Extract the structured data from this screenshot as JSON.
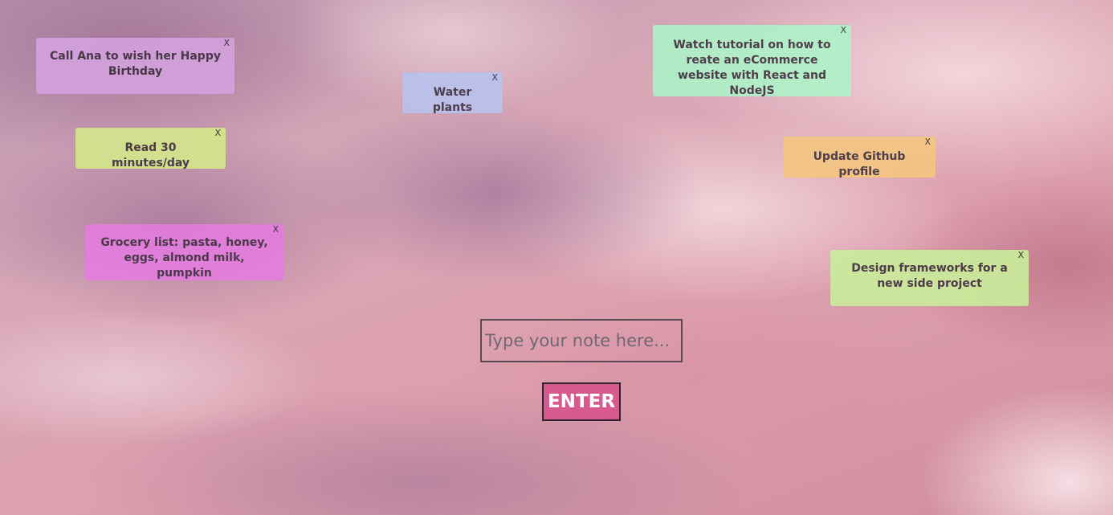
{
  "notes": [
    {
      "text": "Call Ana to wish her Happy Birthday",
      "close": "X",
      "color": "#d6a3e0"
    },
    {
      "text": "Read 30 minutes/day",
      "close": "X",
      "color": "#d5ea8a"
    },
    {
      "text": "Grocery list: pasta, honey, eggs, almond milk, pumpkin",
      "close": "X",
      "color": "#e57ce0"
    },
    {
      "text": "Water plants",
      "close": "X",
      "color": "#b8c3f0"
    },
    {
      "text": "Watch tutorial on how to reate an eCommerce website with React and NodeJS",
      "close": "X",
      "color": "#acf5c8"
    },
    {
      "text": "Update Github profile",
      "close": "X",
      "color": "#f5c67e"
    },
    {
      "text": "Design frameworks for a new side project",
      "close": "X",
      "color": "#c9f09a"
    }
  ],
  "form": {
    "placeholder": "Type your note here...",
    "value": "",
    "enter_label": "ENTER",
    "enter_color": "#d65a8e"
  }
}
